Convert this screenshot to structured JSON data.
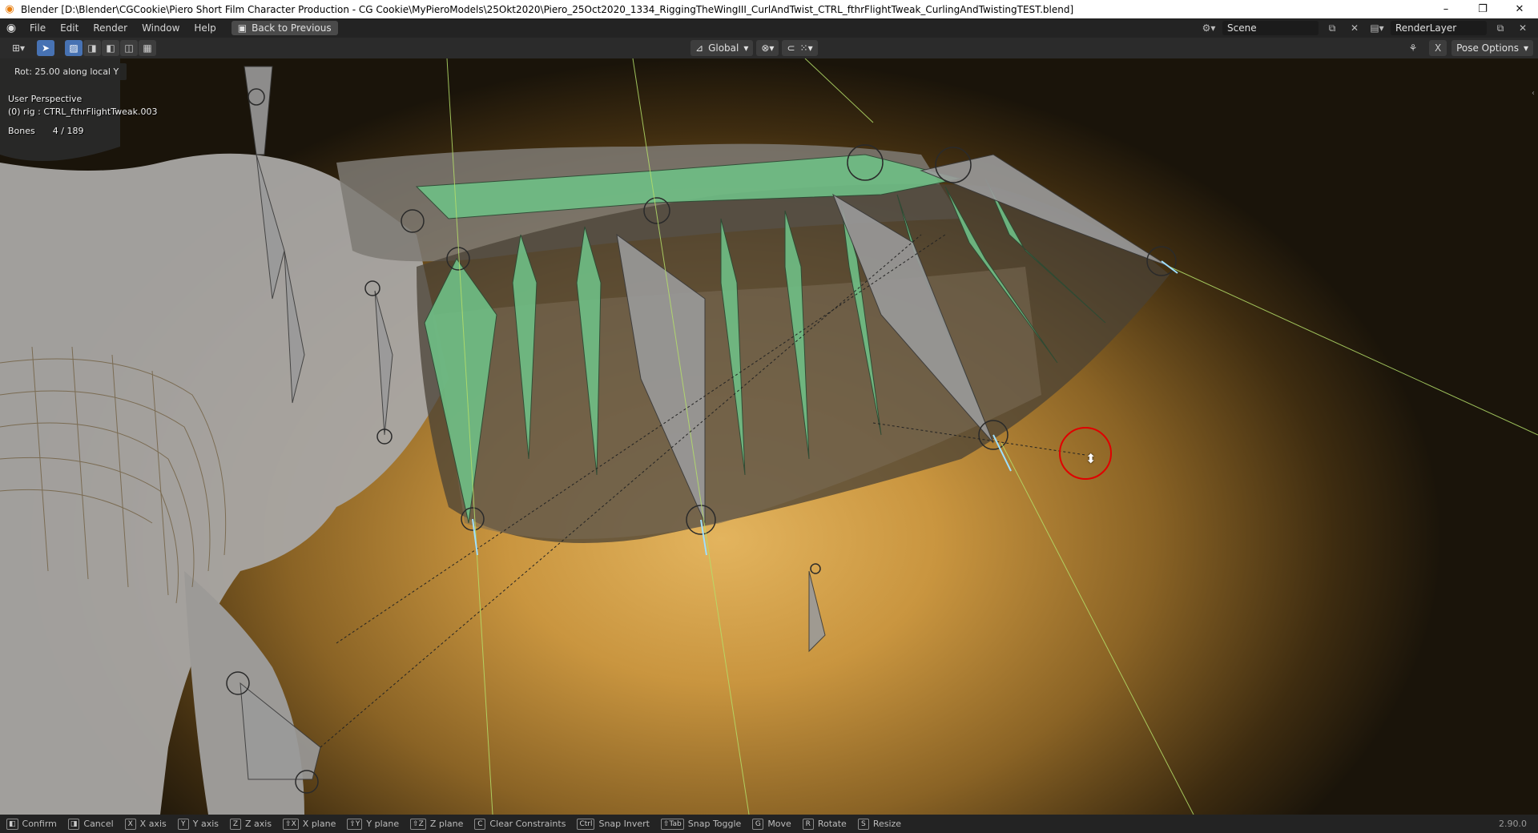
{
  "window": {
    "title": "Blender [D:\\Blender\\CGCookie\\Piero Short Film Character Production - CG Cookie\\MyPieroModels\\25Okt2020\\Piero_25Oct2020_1334_RiggingTheWingIII_CurlAndTwist_CTRL_fthrFlightTweak_CurlingAndTwistingTEST.blend]",
    "minimize": "–",
    "restore": "❐",
    "close": "✕"
  },
  "menu": {
    "items": [
      "File",
      "Edit",
      "Render",
      "Window",
      "Help"
    ],
    "back_button": "Back to Previous",
    "scene": "Scene",
    "render_layer": "RenderLayer"
  },
  "toolbar": {
    "orientation": "Global",
    "pose_options": "Pose Options",
    "x_label": "X"
  },
  "viewport": {
    "operator_text": "Rot: 25.00 along local Y",
    "view_name": "User Perspective",
    "active_object": "(0) rig : CTRL_fthrFlightTweak.003",
    "bones_label": "Bones",
    "bones_value": "4 / 189"
  },
  "statusbar": {
    "hints": [
      {
        "key": "◧",
        "label": "Confirm"
      },
      {
        "key": "◨",
        "label": "Cancel"
      },
      {
        "key": "X",
        "label": "X axis"
      },
      {
        "key": "Y",
        "label": "Y axis"
      },
      {
        "key": "Z",
        "label": "Z axis"
      },
      {
        "key": "⇧X",
        "label": "X plane"
      },
      {
        "key": "⇧Y",
        "label": "Y plane"
      },
      {
        "key": "⇧Z",
        "label": "Z plane"
      },
      {
        "key": "C",
        "label": "Clear Constraints"
      },
      {
        "key": "Ctrl",
        "label": "Snap Invert"
      },
      {
        "key": "⇧Tab",
        "label": "Snap Toggle"
      },
      {
        "key": "G",
        "label": "Move"
      },
      {
        "key": "R",
        "label": "Rotate"
      },
      {
        "key": "S",
        "label": "Resize"
      }
    ],
    "version": "2.90.0"
  },
  "colors": {
    "bone_selected": "#6fbf86",
    "bone_gray": "#9a9a9a",
    "active_bone": "#9fe0ff",
    "cursor_ring": "#e00000",
    "accent": "#4772b3"
  }
}
